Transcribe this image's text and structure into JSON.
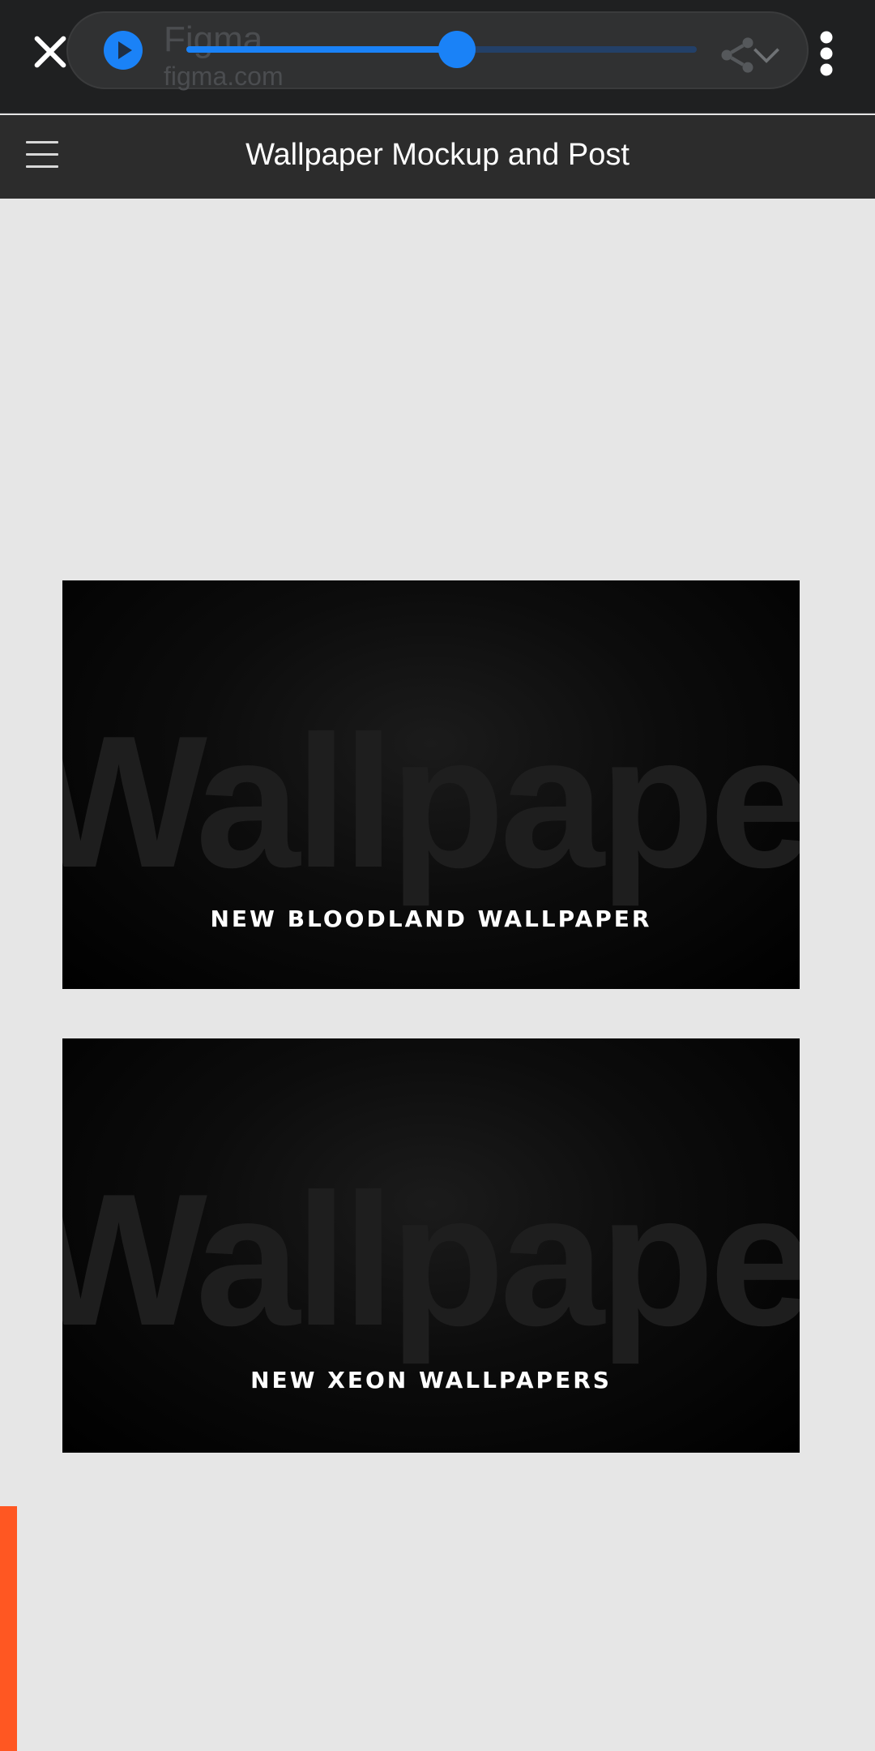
{
  "browser": {
    "site_title": "Figma",
    "site_url": "figma.com"
  },
  "media_player": {
    "progress": 0.53
  },
  "figma": {
    "document_title": "Wallpaper Mockup and Post"
  },
  "frames": [
    {
      "watermark": "Wallpapers",
      "caption": "NEW BLOODLAND WALLPAPER"
    },
    {
      "watermark": "Wallpapers",
      "caption": "NEW XEON WALLPAPERS"
    }
  ],
  "icons": {
    "close": "close-icon",
    "play": "play-icon",
    "share": "share-icon",
    "chevron": "chevron-down-icon",
    "menu": "more-vert-icon",
    "hamburger": "hamburger-icon",
    "lock": "lock-icon"
  },
  "colors": {
    "accent": "#1a82f7",
    "orange": "#ff5722",
    "canvas": "#e6e6e6"
  }
}
